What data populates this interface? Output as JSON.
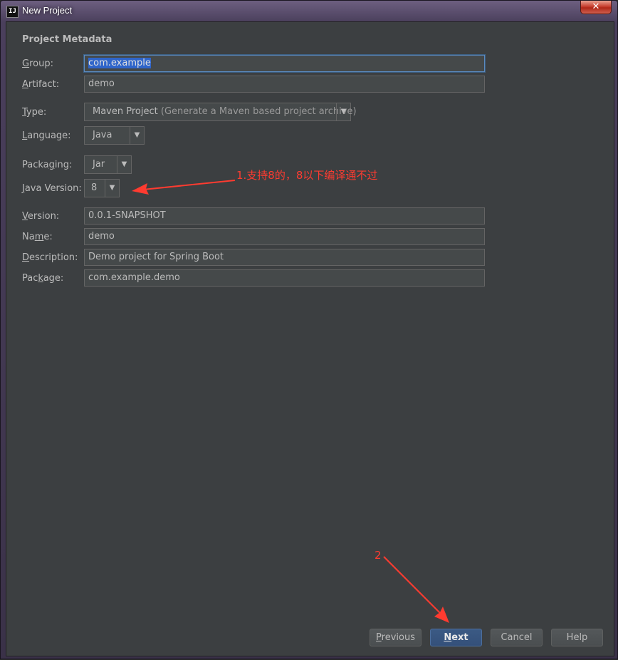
{
  "window": {
    "title": "New Project",
    "app_icon_text": "IJ",
    "close_symbol": "✕"
  },
  "metadata": {
    "section_title": "Project Metadata",
    "group": {
      "label": "Group:",
      "mnemonic": "G",
      "rest": "roup:",
      "value": "com.example"
    },
    "artifact": {
      "label": "Artifact:",
      "mnemonic": "A",
      "rest": "rtifact:",
      "value": "demo"
    },
    "type": {
      "label": "Type:",
      "mnemonic": "T",
      "rest": "ype:",
      "value": "Maven Project",
      "hint": "(Generate a Maven based project archive)"
    },
    "language": {
      "label": "Language:",
      "mnemonic": "L",
      "rest": "anguage:",
      "value": "Java"
    },
    "packaging": {
      "label": "Packaging:",
      "pre": "Packa",
      "mnemonic": "g",
      "rest": "ing:",
      "value": "Jar"
    },
    "java_version": {
      "label": "Java Version:",
      "mnemonic": "J",
      "rest": "ava Version:",
      "value": "8"
    },
    "version": {
      "label": "Version:",
      "mnemonic": "V",
      "rest": "ersion:",
      "value": "0.0.1-SNAPSHOT"
    },
    "name": {
      "label": "Name:",
      "pre": "Na",
      "mnemonic": "m",
      "rest": "e:",
      "value": "demo"
    },
    "description": {
      "label": "Description:",
      "mnemonic": "D",
      "rest": "escription:",
      "value": "Demo project for Spring Boot"
    },
    "package": {
      "label": "Package:",
      "pre": "Pac",
      "mnemonic": "k",
      "rest": "age:",
      "value": "com.example.demo"
    }
  },
  "buttons": {
    "previous": {
      "label": "Previous",
      "mnemonic": "P",
      "rest": "revious"
    },
    "next": {
      "label": "Next",
      "mnemonic": "N",
      "rest": "ext"
    },
    "cancel": {
      "label": "Cancel"
    },
    "help": {
      "label": "Help"
    }
  },
  "annotations": {
    "note1": "1.支持8的，8以下编译通不过",
    "note2": "2",
    "color": "#ff3b30"
  },
  "icons": {
    "dropdown_arrow": "chevron-down-icon",
    "arrow_glyph": "▼"
  }
}
